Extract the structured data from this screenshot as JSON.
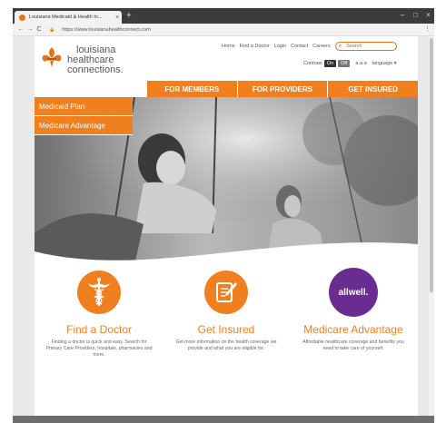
{
  "browser": {
    "tab_title": "Louisiana Medicaid & Health In...",
    "tab_close": "×",
    "new_tab": "+",
    "url": "https://www.louisianahealthconnect.com",
    "secure_label": "🔒",
    "back": "←",
    "forward": "→",
    "reload": "C",
    "menu": "⋮",
    "minimize": "–",
    "maximize": "□",
    "close": "×"
  },
  "logo": {
    "line1": "louisiana",
    "line2": "healthcare",
    "line3": "connections."
  },
  "toplinks": {
    "home": "Home",
    "find_doctor": "Find a Doctor",
    "login": "Login",
    "contact": "Contact",
    "careers": "Careers",
    "search_placeholder": "Search"
  },
  "contrast": {
    "label": "Contrast",
    "on": "On",
    "off": "Off",
    "font_sizes": "a a a",
    "language": "language ▾"
  },
  "nav": {
    "members": "FOR MEMBERS",
    "providers": "FOR PROVIDERS",
    "insured": "GET INSURED"
  },
  "dropdown": {
    "item1": "Medicaid Plan",
    "item2": "Medicare Advantage"
  },
  "cards": [
    {
      "title": "Find a Doctor",
      "desc": "Finding a doctor is quick and easy. Search for Primary Care Providers, hospitals, pharmacies and more."
    },
    {
      "title": "Get Insured",
      "desc": "Get more information on the health coverage we provide and what you are eligible for."
    },
    {
      "title": "Medicare Advantage",
      "desc": "Affordable healthcare coverage and benefits you need to take care of yourself.",
      "logo_text": "allwell."
    }
  ],
  "colors": {
    "brand_orange": "#f07f1f",
    "allwell_purple": "#6b2c91"
  }
}
